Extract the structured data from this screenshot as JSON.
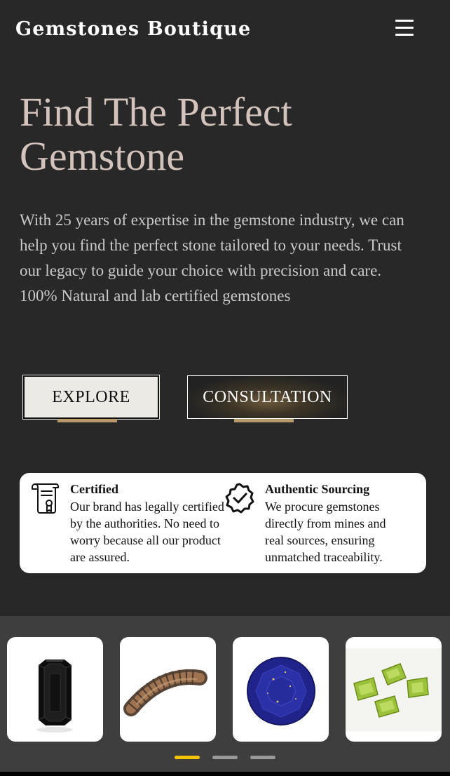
{
  "header": {
    "brand": "Gemstones Boutique",
    "menu_icon": "hamburger-menu-icon"
  },
  "hero": {
    "title": "Find The Perfect Gemstone",
    "description": "With 25 years of expertise in the gemstone industry, we can help you find the perfect stone tailored to your needs. Trust our legacy to guide your choice with precision and care. 100% Natural and lab certified gemstones",
    "buttons": {
      "explore": "EXPLORE",
      "consultation": "CONSULTATION"
    }
  },
  "features": [
    {
      "icon": "certificate-scroll-icon",
      "title": "Certified",
      "text": "Our brand has legally certified by the authorities. No need to worry because all our product are assured."
    },
    {
      "icon": "verified-badge-icon",
      "title": "Authentic Sourcing",
      "text": "We procure gemstones directly from mines and real sources, ensuring unmatched traceability."
    }
  ],
  "carousel": {
    "items": [
      {
        "icon": "black-emerald-cut-gem-icon"
      },
      {
        "icon": "curved-bead-strand-icon"
      },
      {
        "icon": "lapis-lazuli-round-gem-icon"
      },
      {
        "icon": "peridot-gems-cluster-icon"
      }
    ],
    "active_page": 1,
    "page_count": 3
  },
  "colors": {
    "background": "#282828",
    "title": "#d4c3bc",
    "accent": "#b89a6a",
    "dot_active": "#f5c400",
    "dot_inactive": "#9a9a9a"
  }
}
